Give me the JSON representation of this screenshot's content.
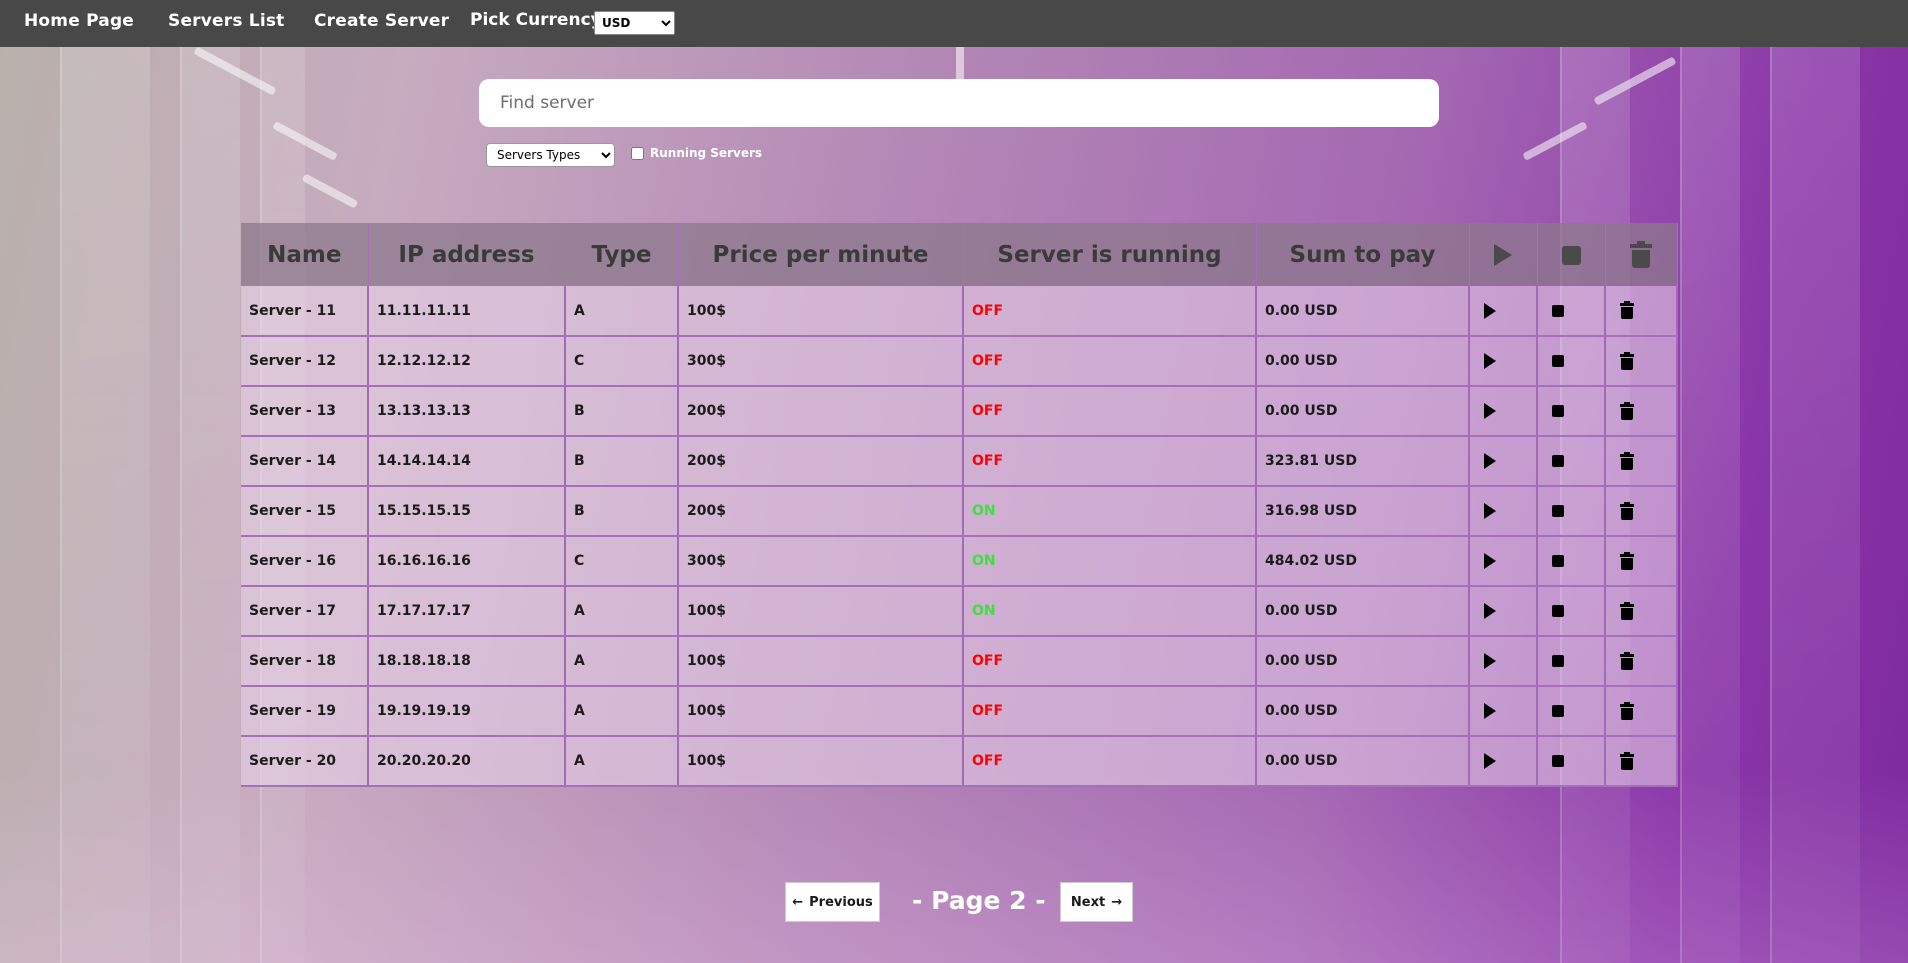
{
  "nav": {
    "home": "Home Page",
    "servers_list": "Servers List",
    "create_server": "Create Server",
    "pick_currency": "Pick Currency",
    "currency_selected": "USD"
  },
  "search": {
    "placeholder": "Find server"
  },
  "filters": {
    "types_selected": "Servers Types",
    "running_label": "Running Servers"
  },
  "table": {
    "headers": [
      "Name",
      "IP address",
      "Type",
      "Price per minute",
      "Server is running",
      "Sum to pay"
    ],
    "header_icons": [
      "play-icon",
      "stop-icon",
      "trash-icon"
    ],
    "rows": [
      {
        "name": "Server - 11",
        "ip": "11.11.11.11",
        "type": "A",
        "price": "100$",
        "running": "OFF",
        "sum": "0.00 USD"
      },
      {
        "name": "Server - 12",
        "ip": "12.12.12.12",
        "type": "C",
        "price": "300$",
        "running": "OFF",
        "sum": "0.00 USD"
      },
      {
        "name": "Server - 13",
        "ip": "13.13.13.13",
        "type": "B",
        "price": "200$",
        "running": "OFF",
        "sum": "0.00 USD"
      },
      {
        "name": "Server - 14",
        "ip": "14.14.14.14",
        "type": "B",
        "price": "200$",
        "running": "OFF",
        "sum": "323.81 USD"
      },
      {
        "name": "Server - 15",
        "ip": "15.15.15.15",
        "type": "B",
        "price": "200$",
        "running": "ON",
        "sum": "316.98 USD"
      },
      {
        "name": "Server - 16",
        "ip": "16.16.16.16",
        "type": "C",
        "price": "300$",
        "running": "ON",
        "sum": "484.02 USD"
      },
      {
        "name": "Server - 17",
        "ip": "17.17.17.17",
        "type": "A",
        "price": "100$",
        "running": "ON",
        "sum": "0.00 USD"
      },
      {
        "name": "Server - 18",
        "ip": "18.18.18.18",
        "type": "A",
        "price": "100$",
        "running": "OFF",
        "sum": "0.00 USD"
      },
      {
        "name": "Server - 19",
        "ip": "19.19.19.19",
        "type": "A",
        "price": "100$",
        "running": "OFF",
        "sum": "0.00 USD"
      },
      {
        "name": "Server - 20",
        "ip": "20.20.20.20",
        "type": "A",
        "price": "100$",
        "running": "OFF",
        "sum": "0.00 USD"
      }
    ]
  },
  "pagination": {
    "previous": "Previous",
    "next": "Next",
    "page_label": "- Page 2 -"
  },
  "colors": {
    "nav_bg": "#484848",
    "off": "#ff0000",
    "on": "#3ee03e"
  }
}
